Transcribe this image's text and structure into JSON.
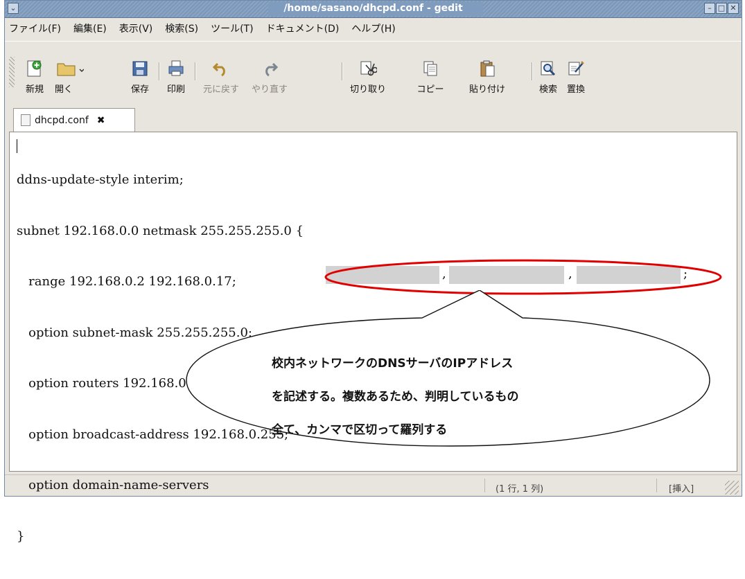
{
  "window": {
    "title": "/home/sasano/dhcpd.conf - gedit"
  },
  "menubar": {
    "items": [
      "ファイル(F)",
      "編集(E)",
      "表示(V)",
      "検索(S)",
      "ツール(T)",
      "ドキュメント(D)",
      "ヘルプ(H)"
    ]
  },
  "toolbar": {
    "new_label": "新規",
    "open_label": "開く",
    "save_label": "保存",
    "print_label": "印刷",
    "undo_label": "元に戻す",
    "redo_label": "やり直す",
    "cut_label": "切り取り",
    "copy_label": "コピー",
    "paste_label": "貼り付け",
    "find_label": "検索",
    "replace_label": "置換"
  },
  "tab": {
    "label": "dhcpd.conf",
    "close": "✖"
  },
  "editor": {
    "lines": [
      "ddns-update-style interim;",
      "subnet 192.168.0.0 netmask 255.255.255.0 {",
      "   range 192.168.0.2 192.168.0.17;",
      "   option subnet-mask 255.255.255.0;",
      "   option routers 192.168.0.1;",
      "   option broadcast-address 192.168.0.255;",
      "   option domain-name-servers",
      "}"
    ],
    "dns_separators": [
      ",",
      ",",
      ";"
    ]
  },
  "callout": {
    "lines": [
      "校内ネットワークのDNSサーバのIPアドレス",
      "を記述する。複数あるため、判明しているもの",
      "全て、カンマで区切って羅列する"
    ],
    "color": "#e00000"
  },
  "status": {
    "position": "(1 行, 1 列)",
    "mode": "[挿入]"
  }
}
